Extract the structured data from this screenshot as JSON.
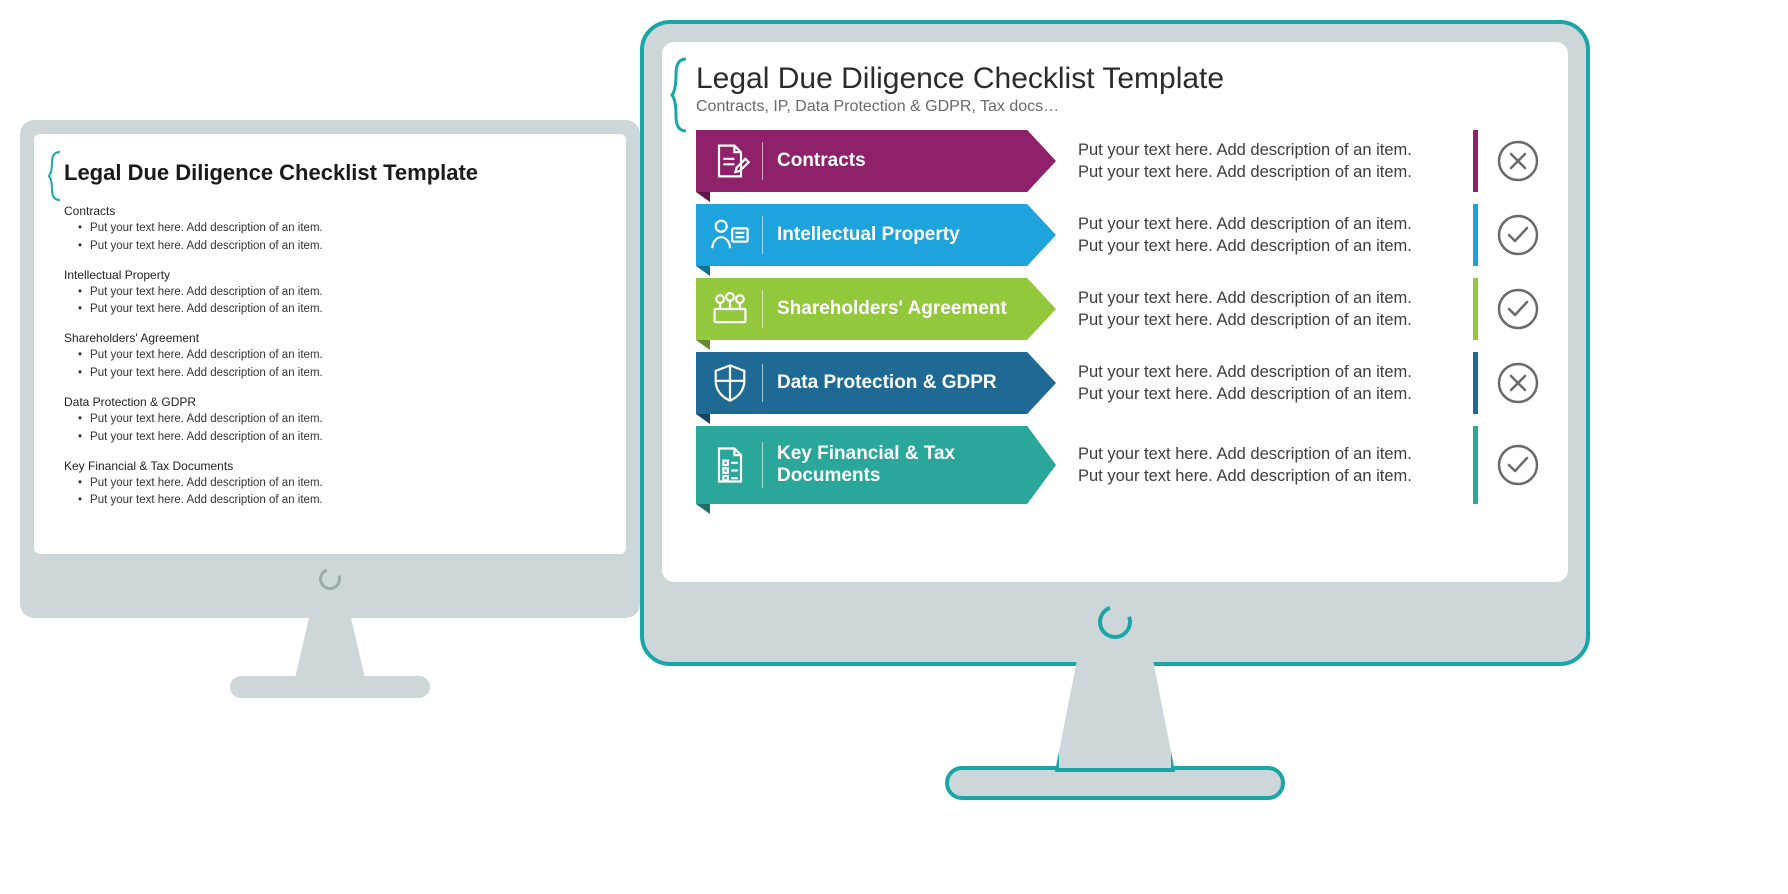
{
  "left": {
    "title": "Legal Due Diligence Checklist Template",
    "bullet": "Put your text here. Add description of an item.",
    "sections": {
      "s1": "Contracts",
      "s2": "Intellectual Property",
      "s3": "Shareholders' Agreement",
      "s4": "Data Protection & GDPR",
      "s5": "Key Financial & Tax Documents"
    }
  },
  "right": {
    "title": "Legal Due Diligence Checklist Template",
    "subtitle": "Contracts, IP, Data Protection & GDPR, Tax docs…",
    "desc_line": "Put your text here. Add description of an item.",
    "rows": {
      "r1": {
        "label": "Contracts",
        "status": "x"
      },
      "r2": {
        "label": "Intellectual Property",
        "status": "check"
      },
      "r3": {
        "label": "Shareholders' Agreement",
        "status": "check"
      },
      "r4": {
        "label": "Data Protection & GDPR",
        "status": "x"
      },
      "r5": {
        "label": "Key Financial & Tax\nDocuments",
        "status": "check"
      }
    }
  }
}
